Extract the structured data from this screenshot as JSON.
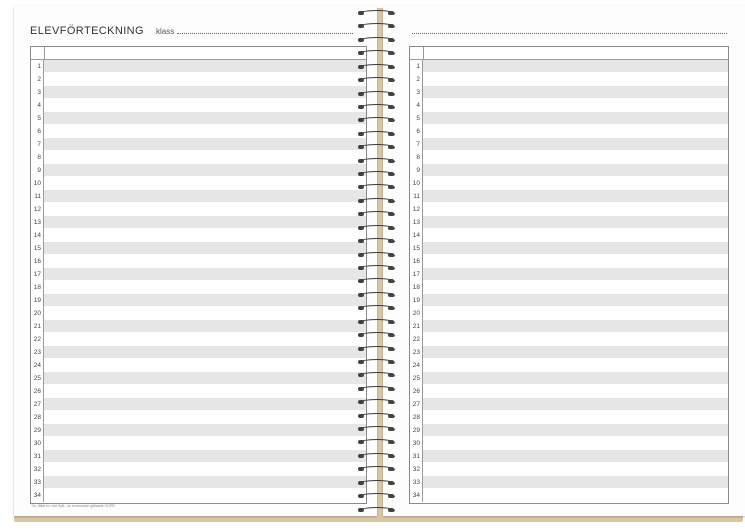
{
  "planner": {
    "left_page": {
      "title": "ELEVFÖRTECKNING",
      "class_label": "klass",
      "row_numbers": [
        "1",
        "2",
        "3",
        "4",
        "5",
        "6",
        "7",
        "8",
        "9",
        "10",
        "11",
        "12",
        "13",
        "14",
        "15",
        "16",
        "17",
        "18",
        "19",
        "20",
        "21",
        "22",
        "23",
        "24",
        "25",
        "26",
        "27",
        "28",
        "29",
        "30",
        "31",
        "32",
        "33",
        "34"
      ],
      "footnote": "Tid, fältet ev. inte ifyllt - av kommunen gällande GDPR"
    },
    "right_page": {
      "row_numbers": [
        "1",
        "2",
        "3",
        "4",
        "5",
        "6",
        "7",
        "8",
        "9",
        "10",
        "11",
        "12",
        "13",
        "14",
        "15",
        "16",
        "17",
        "18",
        "19",
        "20",
        "21",
        "22",
        "23",
        "24",
        "25",
        "26",
        "27",
        "28",
        "29",
        "30",
        "31",
        "32",
        "33",
        "34"
      ]
    }
  }
}
